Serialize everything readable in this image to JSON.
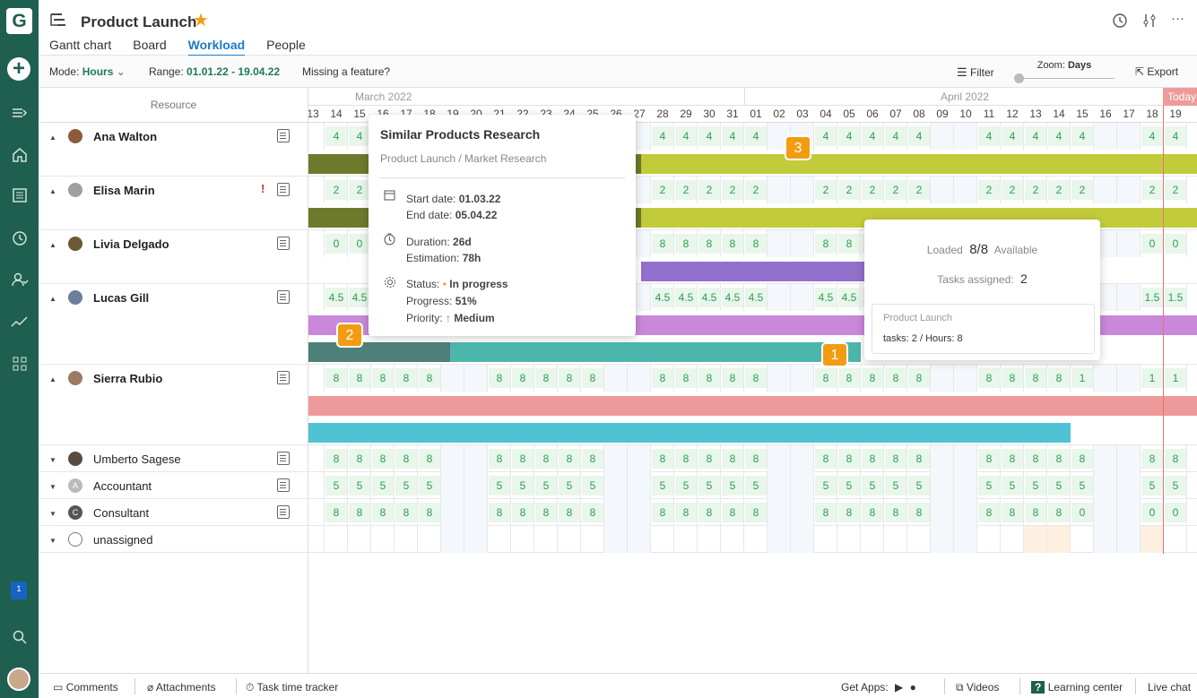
{
  "app": {
    "logo_letter": "G",
    "notification_count": "1"
  },
  "rail_icons": [
    "home-icon",
    "list-icon",
    "clock-icon",
    "people-icon",
    "chart-icon",
    "apps-icon",
    "search-icon"
  ],
  "header": {
    "title": "Product Launch",
    "tabs": [
      {
        "label": "Gantt chart",
        "active": false
      },
      {
        "label": "Board",
        "active": false
      },
      {
        "label": "Workload",
        "active": true
      },
      {
        "label": "People",
        "active": false
      }
    ]
  },
  "toolbar": {
    "mode_label": "Mode:",
    "mode_value": "Hours",
    "range_label": "Range:",
    "range_value": "01.01.22 - 19.04.22",
    "missing_feature": "Missing a feature?",
    "filter": "Filter",
    "zoom_label": "Zoom:",
    "zoom_value": "Days",
    "export": "Export"
  },
  "resource_header": "Resource",
  "resources": [
    {
      "name": "Ana Walton",
      "expanded": true,
      "avatar": "#8d5a3b"
    },
    {
      "name": "Elisa Marin",
      "expanded": true,
      "avatar": "#a0a0a0",
      "flag": "person-icon"
    },
    {
      "name": "Livia Delgado",
      "expanded": true,
      "avatar": "#6b5a33"
    },
    {
      "name": "Lucas Gill",
      "expanded": true,
      "avatar": "#6d7f9a"
    },
    {
      "name": "Sierra Rubio",
      "expanded": true,
      "avatar": "#9b7b63"
    },
    {
      "name": "Umberto Sagese",
      "expanded": false,
      "avatar": "#5a4a3e"
    },
    {
      "name": "Accountant",
      "expanded": false,
      "avatar": "#bbbbbb",
      "initial": "A"
    },
    {
      "name": "Consultant",
      "expanded": false,
      "avatar": "#555555",
      "initial": "C"
    },
    {
      "name": "unassigned",
      "expanded": false,
      "avatar": "none"
    }
  ],
  "timeline": {
    "months": [
      "March 2022",
      "April 2022"
    ],
    "today_label": "Today",
    "days": [
      "13",
      "14",
      "15",
      "16",
      "17",
      "18",
      "19",
      "20",
      "21",
      "22",
      "23",
      "24",
      "25",
      "26",
      "27",
      "28",
      "29",
      "30",
      "31",
      "01",
      "02",
      "03",
      "04",
      "05",
      "06",
      "07",
      "08",
      "09",
      "10",
      "11",
      "12",
      "13",
      "14",
      "15",
      "16",
      "17",
      "18",
      "19"
    ]
  },
  "workload_rows": [
    [
      "",
      "4",
      "4",
      "4",
      "4",
      "4",
      "",
      "",
      "4",
      "4",
      "4",
      "4",
      "4",
      "",
      "",
      "4",
      "4",
      "4",
      "4",
      "4",
      "",
      "",
      "4",
      "4",
      "4",
      "4",
      "4",
      "",
      "",
      "4",
      "4",
      "4",
      "4",
      "4",
      "",
      "",
      "4",
      "4"
    ],
    [
      "",
      "2",
      "2",
      "2",
      "2",
      "2",
      "",
      "",
      "2",
      "2",
      "2",
      "2",
      "2",
      "",
      "",
      "2",
      "2",
      "2",
      "2",
      "2",
      "",
      "",
      "2",
      "2",
      "2",
      "2",
      "2",
      "",
      "",
      "2",
      "2",
      "2",
      "2",
      "2",
      "",
      "",
      "2",
      "2"
    ],
    [
      "",
      "0",
      "0",
      "8",
      "8",
      "8",
      "",
      "",
      "8",
      "8",
      "8",
      "8",
      "8",
      "",
      "",
      "8",
      "8",
      "8",
      "8",
      "8",
      "",
      "",
      "8",
      "8",
      "8",
      "8",
      "8",
      "",
      "",
      "8",
      "8",
      "8",
      "8",
      "8",
      "",
      "",
      "0",
      "0"
    ],
    [
      "",
      "4.5",
      "4.5",
      "4.5",
      "4.5",
      "4.5",
      "",
      "",
      "4.5",
      "4.5",
      "4.5",
      "4.5",
      "4.5",
      "",
      "",
      "4.5",
      "4.5",
      "4.5",
      "4.5",
      "4.5",
      "",
      "",
      "4.5",
      "4.5",
      "4.5",
      "4.5",
      "4.5",
      "",
      "",
      "4.5",
      "4.5",
      "4.5",
      "4.5",
      "4.5",
      "",
      "",
      "1.5",
      "1.5"
    ],
    [
      "",
      "8",
      "8",
      "8",
      "8",
      "8",
      "",
      "",
      "8",
      "8",
      "8",
      "8",
      "8",
      "",
      "",
      "8",
      "8",
      "8",
      "8",
      "8",
      "",
      "",
      "8",
      "8",
      "8",
      "8",
      "8",
      "",
      "",
      "8",
      "8",
      "8",
      "8",
      "1",
      "",
      "",
      "1",
      "1"
    ],
    [
      "",
      "8",
      "8",
      "8",
      "8",
      "8",
      "",
      "",
      "8",
      "8",
      "8",
      "8",
      "8",
      "",
      "",
      "8",
      "8",
      "8",
      "8",
      "8",
      "",
      "",
      "8",
      "8",
      "8",
      "8",
      "8",
      "",
      "",
      "8",
      "8",
      "8",
      "8",
      "8",
      "",
      "",
      "8",
      "8"
    ],
    [
      "",
      "5",
      "5",
      "5",
      "5",
      "5",
      "",
      "",
      "5",
      "5",
      "5",
      "5",
      "5",
      "",
      "",
      "5",
      "5",
      "5",
      "5",
      "5",
      "",
      "",
      "5",
      "5",
      "5",
      "5",
      "5",
      "",
      "",
      "5",
      "5",
      "5",
      "5",
      "5",
      "",
      "",
      "5",
      "5"
    ],
    [
      "",
      "8",
      "8",
      "8",
      "8",
      "8",
      "",
      "",
      "8",
      "8",
      "8",
      "8",
      "8",
      "",
      "",
      "8",
      "8",
      "8",
      "8",
      "8",
      "",
      "",
      "8",
      "8",
      "8",
      "8",
      "8",
      "",
      "",
      "8",
      "8",
      "8",
      "8",
      "0",
      "",
      "",
      "0",
      "0"
    ]
  ],
  "task_tooltip": {
    "title": "Similar Products Research",
    "path": "Product Launch / Market Research",
    "start_label": "Start date:",
    "start": "01.03.22",
    "end_label": "End date:",
    "end": "05.04.22",
    "duration_label": "Duration:",
    "duration": "26d",
    "estimation_label": "Estimation:",
    "estimation": "78h",
    "status_label": "Status:",
    "status": "In progress",
    "progress_label": "Progress:",
    "progress": "51%",
    "priority_label": "Priority:",
    "priority": "Medium"
  },
  "load_tooltip": {
    "loaded_label": "Loaded",
    "loaded": "8/8",
    "available": "Available",
    "tasks_label": "Tasks assigned:",
    "tasks": "2",
    "project": "Product Launch",
    "project_detail": "tasks: 2 / Hours: 8"
  },
  "badges": [
    "1",
    "2",
    "3"
  ],
  "colors": {
    "rail": "#1f5f4f",
    "accent": "#1e7bc4",
    "badge": "#f39c12",
    "value": "#2e9e4e"
  },
  "footer": {
    "comments": "Comments",
    "attachments": "Attachments",
    "time_tracker": "Task time tracker",
    "get_apps": "Get Apps:",
    "videos": "Videos",
    "learning": "Learning center",
    "chat": "Live chat"
  }
}
